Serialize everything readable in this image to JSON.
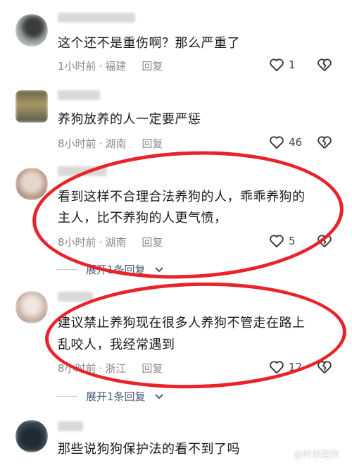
{
  "comments": [
    {
      "text": "这个还不是重伤啊？那么严重了",
      "time": "1小时前",
      "location": "福建",
      "reply": "回复",
      "likes": "1"
    },
    {
      "text": "养狗放养的人一定要严惩",
      "time": "8小时前",
      "location": "湖南",
      "reply": "回复",
      "likes": "46"
    },
    {
      "text_line1": "看到这样不合理合法养狗的人，乖乖养狗的",
      "text_line2": "主人，比不养狗的人更气愤，",
      "time": "8小时前",
      "location": "湖南",
      "reply": "回复",
      "likes": "5",
      "expand": "展开1条回复"
    },
    {
      "text_line1": "建议禁止养狗现在很多人养狗不管走在路上",
      "text_line2": "乱咬人，我经常遇到",
      "time": "8小时前",
      "location": "浙江",
      "reply": "回复",
      "likes": "12",
      "expand": "展开1条回复"
    },
    {
      "text": "那些说狗狗保护法的看不到了吗"
    }
  ],
  "separator": "·",
  "watermark": "@时来运转",
  "colors": {
    "annotation_red": "#e8232a",
    "meta_gray": "#8a8a8a",
    "expand_blue": "#4a5a7a"
  }
}
